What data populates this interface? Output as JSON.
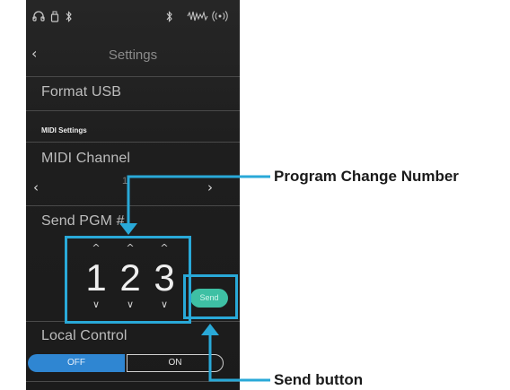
{
  "status_bar": {
    "icons": [
      "headphones-icon",
      "usb-icon",
      "bluetooth-icon",
      "bluetooth-audio-icon",
      "sound-wave-icon",
      "wireless-icon"
    ],
    "glyphs": [
      "℗",
      "⎘",
      "ᚼ",
      "ᚼ",
      "≣",
      "◎"
    ]
  },
  "nav": {
    "back_glyph": "‹",
    "title": "Settings"
  },
  "menu": {
    "format_usb": "Format USB",
    "midi_section_header": "MIDI Settings",
    "midi_channel": "MIDI Channel",
    "midi_channel_value": "1",
    "arrow_left": "‹",
    "arrow_right": "›",
    "send_pgm": "Send PGM #",
    "local_control": "Local Control"
  },
  "pgm_picker": {
    "digits": [
      {
        "up": "^",
        "value": "1",
        "down": "∨"
      },
      {
        "up": "^",
        "value": "2",
        "down": "∨"
      },
      {
        "up": "^",
        "value": "3",
        "down": "∨"
      }
    ],
    "send_label": "Send"
  },
  "local_control_toggle": {
    "off_label": "OFF",
    "on_label": "ON",
    "selected": "OFF"
  },
  "annotations": {
    "program_change_number": "Program Change Number",
    "send_button": "Send button",
    "color": "#29a9d8"
  }
}
